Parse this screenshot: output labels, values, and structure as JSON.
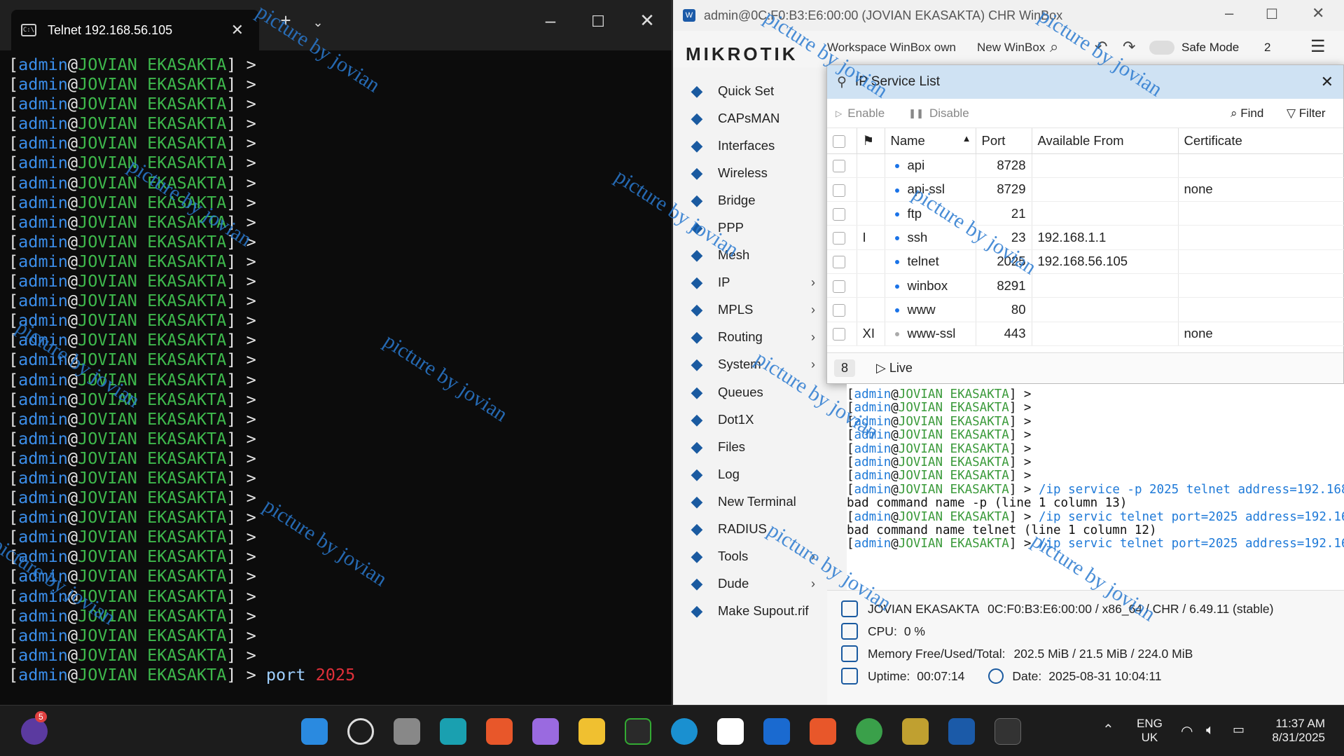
{
  "telnet": {
    "tab_title": "Telnet 192.168.56.105",
    "prompt_user": "admin",
    "prompt_host": "JOVIAN EKASAKTA",
    "prompt_count": 32,
    "last_cmd": "port",
    "last_num": "2025"
  },
  "winbox": {
    "title": "admin@0C:F0:B3:E6:00:00 (JOVIAN EKASAKTA) CHR WinBox",
    "brand": "MIKROTIK",
    "toolbar": {
      "tabs_text": "Workspace WinBox own",
      "new_winbox": "New WinBox",
      "safe_mode": "Safe Mode",
      "count": "2"
    },
    "sidebar": [
      {
        "label": "Quick Set",
        "icon": "wand-icon",
        "sub": false
      },
      {
        "label": "CAPsMAN",
        "icon": "antenna-icon",
        "sub": false
      },
      {
        "label": "Interfaces",
        "icon": "interfaces-icon",
        "sub": false
      },
      {
        "label": "Wireless",
        "icon": "wifi-icon",
        "sub": false
      },
      {
        "label": "Bridge",
        "icon": "bridge-icon",
        "sub": false
      },
      {
        "label": "PPP",
        "icon": "ppp-icon",
        "sub": false
      },
      {
        "label": "Mesh",
        "icon": "mesh-icon",
        "sub": false
      },
      {
        "label": "IP",
        "icon": "ip-icon",
        "sub": true
      },
      {
        "label": "MPLS",
        "icon": "mpls-icon",
        "sub": true
      },
      {
        "label": "Routing",
        "icon": "routing-icon",
        "sub": true
      },
      {
        "label": "System",
        "icon": "gear-icon",
        "sub": true
      },
      {
        "label": "Queues",
        "icon": "queues-icon",
        "sub": false
      },
      {
        "label": "Dot1X",
        "icon": "dot1x-icon",
        "sub": false
      },
      {
        "label": "Files",
        "icon": "folder-icon",
        "sub": false
      },
      {
        "label": "Log",
        "icon": "log-icon",
        "sub": false
      },
      {
        "label": "New Terminal",
        "icon": "terminal-icon",
        "sub": false
      },
      {
        "label": "RADIUS",
        "icon": "radius-icon",
        "sub": false
      },
      {
        "label": "Tools",
        "icon": "tools-icon",
        "sub": true
      },
      {
        "label": "Dude",
        "icon": "dude-icon",
        "sub": true
      },
      {
        "label": "Make Supout.rif",
        "icon": "supout-icon",
        "sub": false
      }
    ],
    "ip_service": {
      "title": "IP Service List",
      "enable": "Enable",
      "disable": "Disable",
      "find": "Find",
      "filter": "Filter",
      "headers": {
        "name": "Name",
        "port": "Port",
        "available_from": "Available From",
        "certificate": "Certificate"
      },
      "rows": [
        {
          "flags": "",
          "name": "api",
          "port": "8728",
          "from": "",
          "cert": "",
          "disabled": false
        },
        {
          "flags": "",
          "name": "api-ssl",
          "port": "8729",
          "from": "",
          "cert": "none",
          "disabled": false
        },
        {
          "flags": "",
          "name": "ftp",
          "port": "21",
          "from": "",
          "cert": "",
          "disabled": false
        },
        {
          "flags": "I",
          "name": "ssh",
          "port": "23",
          "from": "192.168.1.1",
          "cert": "",
          "disabled": false
        },
        {
          "flags": "",
          "name": "telnet",
          "port": "2025",
          "from": "192.168.56.105",
          "cert": "",
          "disabled": false
        },
        {
          "flags": "",
          "name": "winbox",
          "port": "8291",
          "from": "",
          "cert": "",
          "disabled": false
        },
        {
          "flags": "",
          "name": "www",
          "port": "80",
          "from": "",
          "cert": "",
          "disabled": false
        },
        {
          "flags": "XI",
          "name": "www-ssl",
          "port": "443",
          "from": "",
          "cert": "none",
          "disabled": true
        }
      ],
      "count": "8",
      "live": "Live"
    },
    "terminal": {
      "prompt": "[admin@JOVIAN EKASAKTA] >",
      "plain_prompts": 7,
      "lines": [
        {
          "cmd": "/ip service -p 2025 telnet address=192.168"
        },
        {
          "err": "bad command name -p (line 1 column 13)"
        },
        {
          "cmd": "/ip servic telnet port=2025 address=192.16"
        },
        {
          "err": "bad command name telnet (line 1 column 12)"
        },
        {
          "cmd": "/ip servic telnet port=2025 address=192.16"
        }
      ]
    },
    "status": {
      "identity": "JOVIAN EKASAKTA",
      "board": "0C:F0:B3:E6:00:00 / x86_64 / CHR / 6.49.11 (stable)",
      "cpu_label": "CPU:",
      "cpu": "0 %",
      "mem_label": "Memory Free/Used/Total:",
      "mem": "202.5 MiB / 21.5 MiB / 224.0 MiB",
      "uptime_label": "Uptime:",
      "uptime": "00:07:14",
      "date_label": "Date:",
      "date": "2025-08-31 10:04:11"
    }
  },
  "watermark": "picture by jovian",
  "taskbar": {
    "badge": "5",
    "lang": "ENG",
    "region": "UK",
    "time": "11:37 AM",
    "date": "8/31/2025"
  }
}
